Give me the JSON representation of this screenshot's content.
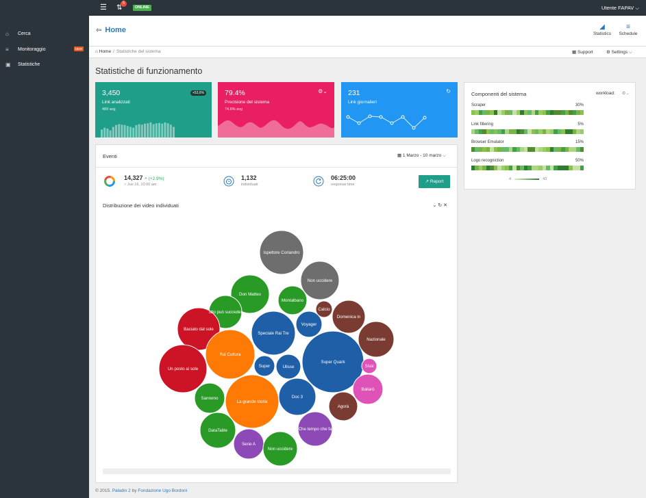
{
  "topbar": {
    "notif_count": "5",
    "status": "ONLINE",
    "user": "Utente FAPAV ⌵"
  },
  "sidebar": {
    "items": [
      {
        "label": "Cerca",
        "icon": "home-icon"
      },
      {
        "label": "Monitoraggio",
        "icon": "list-icon",
        "badge": "NEW"
      },
      {
        "label": "Statistiche",
        "icon": "monitor-icon"
      }
    ]
  },
  "header": {
    "title": "Home",
    "buttons": [
      {
        "label": "Statistics",
        "icon": "signal-icon"
      },
      {
        "label": "Schedule",
        "icon": "tasks-icon"
      }
    ]
  },
  "breadcrumb": {
    "home": "Home",
    "current": "Statistiche del sistema",
    "support": "Support",
    "settings": "Settings ⌵"
  },
  "page_title": "Statistiche di funzionamento",
  "tiles": [
    {
      "value": "3,450",
      "label": "Link analizzati",
      "sub": "489 avg",
      "badge": "+53,6%",
      "color": "#1f9e89",
      "bars": [
        0.45,
        0.55,
        0.5,
        0.4,
        0.6,
        0.7,
        0.75,
        0.72,
        0.7,
        0.65,
        0.6,
        0.55,
        0.7,
        0.75,
        0.72,
        0.78,
        0.8,
        0.85,
        0.75,
        0.8,
        0.82,
        0.78,
        0.85,
        0.8,
        0.72,
        0.6
      ]
    },
    {
      "value": "79.4%",
      "label": "Precisione del sistema",
      "sub": "74.6% avg",
      "color": "#e91e63"
    },
    {
      "value": "231",
      "label": "Link giornalieri",
      "color": "#2196f3"
    }
  ],
  "eventi": {
    "title": "Eventi",
    "range": "1 Marzo - 10 marzo ⌵",
    "stats": [
      {
        "value": "14,327",
        "change": "(+2.9%)",
        "sub": "Jun 16, 10:00 am"
      },
      {
        "value": "1,132",
        "sub": "individuati"
      },
      {
        "value": "06:25:00",
        "sub": "response time"
      }
    ],
    "report": "Report"
  },
  "distribuzione": {
    "title": "Distribuzione dei video individuati"
  },
  "componenti": {
    "title": "Componenti del sistema",
    "workload": "workload:",
    "rows": [
      {
        "name": "Scraper",
        "value": "30%"
      },
      {
        "name": "Link filtering",
        "value": "5%"
      },
      {
        "name": "Browser Emulator",
        "value": "15%"
      },
      {
        "name": "Logo recogniction",
        "value": "50%"
      }
    ],
    "legend_min": "4",
    "legend_max": "43"
  },
  "footer": {
    "year": "© 2015.",
    "app": "Paladin 2",
    "by": "by",
    "org": "Fondazione Ugo Bordoni"
  },
  "bubbles": [
    {
      "label": "Ispettore Coriandro",
      "color": "#6e6e6e"
    },
    {
      "label": "Non uccidere",
      "color": "#6e6e6e"
    },
    {
      "label": "Don Matteo",
      "color": "#2a9a27"
    },
    {
      "label": "Montalbano",
      "color": "#2a9a27"
    },
    {
      "label": "Tutto può succedere",
      "color": "#2a9a27"
    },
    {
      "label": "Calcio",
      "color": "#7a3c32"
    },
    {
      "label": "Domenica in",
      "color": "#7a3c32"
    },
    {
      "label": "Voyager",
      "color": "#1f5fa8"
    },
    {
      "label": "Nazionale",
      "color": "#7a3c32"
    },
    {
      "label": "Baciato dal sole",
      "color": "#cc1426"
    },
    {
      "label": "Speciale Rai Tre",
      "color": "#1f5fa8"
    },
    {
      "label": "Rai Cultura",
      "color": "#ff7a05"
    },
    {
      "label": "Un posto al sole",
      "color": "#cc1426"
    },
    {
      "label": "Super",
      "color": "#1f5fa8"
    },
    {
      "label": "Ulisse",
      "color": "#1f5fa8"
    },
    {
      "label": "Super Quark",
      "color": "#1f5fa8"
    },
    {
      "label": "Sissi",
      "color": "#df52b8"
    },
    {
      "label": "Ballarò",
      "color": "#df52b8"
    },
    {
      "label": "Sanremo",
      "color": "#2a9a27"
    },
    {
      "label": "La grande storia",
      "color": "#ff7a05"
    },
    {
      "label": "Doc 3",
      "color": "#1f5fa8"
    },
    {
      "label": "Agorà",
      "color": "#7a3c32"
    },
    {
      "label": "DataTable",
      "color": "#2a9a27"
    },
    {
      "label": "Che tempo che fa",
      "color": "#8d4ab6"
    },
    {
      "label": "Serie A",
      "color": "#8d4ab6"
    },
    {
      "label": "Non uccidere",
      "color": "#2a9a27"
    }
  ]
}
